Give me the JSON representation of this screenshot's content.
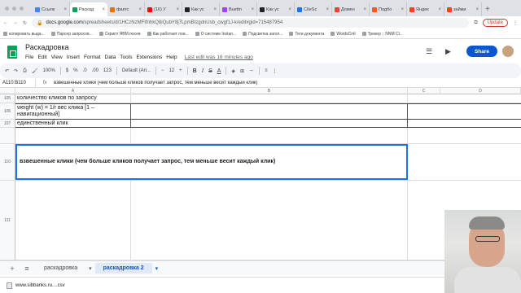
{
  "browser": {
    "tabs": [
      {
        "label": "Ссылк",
        "color": "#4285f4",
        "active": false
      },
      {
        "label": "Раскад",
        "color": "#0f9d58",
        "active": true
      },
      {
        "label": "фактс",
        "color": "#e8710a",
        "active": false
      },
      {
        "label": "(16) У",
        "color": "#ff0000",
        "active": false
      },
      {
        "label": "Как ус",
        "color": "#202124",
        "active": false
      },
      {
        "label": "Buettn",
        "color": "#a142f4",
        "active": false
      },
      {
        "label": "Как ус",
        "color": "#202124",
        "active": false
      },
      {
        "label": "CiteSc",
        "color": "#1a73e8",
        "active": false
      },
      {
        "label": "Домен",
        "color": "#ea4335",
        "active": false
      },
      {
        "label": "Подбо",
        "color": "#ff5722",
        "active": false
      },
      {
        "label": "Яндек",
        "color": "#fc3f1d",
        "active": false
      },
      {
        "label": "займи",
        "color": "#fc3f1d",
        "active": false
      }
    ],
    "url_host": "docs.google.com",
    "url_rest": "/spreadsheets/d/1HCzNzMFIfnhkQ8iQubY8j7LpmBIzgdnUsb_cwgf1J-k/edit#gid=715487954",
    "update_label": "Update",
    "bookmarks": [
      "копировать выда...",
      "Парсер запросов...",
      "Скрипт ЯВМ поcев",
      "Как работает пои...",
      "О системе Instan...",
      "Подсветка загол...",
      "Теги документа",
      "WordsCntl",
      "Трекер :: NNM Cl..."
    ]
  },
  "doc": {
    "title": "Раскадровка",
    "menus": [
      "File",
      "Edit",
      "View",
      "Insert",
      "Format",
      "Data",
      "Tools",
      "Extensions",
      "Help"
    ],
    "last_edit": "Last edit was 16 minutes ago",
    "share_label": "Share"
  },
  "toolbar": {
    "zoom": "100%",
    "currency": "$",
    "percent": "%",
    "dec1": ".0",
    "dec2": ".00",
    "numfmt": "123",
    "font": "Default (Ari...",
    "size": "12",
    "bold": "B",
    "italic": "I",
    "strike": "S",
    "textcolor": "A"
  },
  "formula": {
    "namebox": "A110:B110",
    "fx": "fx",
    "content": "взвешенные клики (чем больше кликов получает запрос, тем меньше весит каждый клик)"
  },
  "columns": [
    "A",
    "B",
    "C",
    "D"
  ],
  "rows": [
    {
      "num": "105",
      "a": "количество кликов по запросу",
      "b": ""
    },
    {
      "num": "106",
      "a": "weight (w) = 1/r вес клика [1 – навигационный]",
      "b": ""
    },
    {
      "num": "107",
      "a": "единственный клик",
      "b": ""
    },
    {
      "num": "108",
      "a": "",
      "b": ""
    },
    {
      "num": "110",
      "a": "взвешенные клики (чем больше кликов получает запрос, тем меньше весит каждый клик)",
      "b": ""
    },
    {
      "num": "111",
      "a": "",
      "b": ""
    }
  ],
  "sheets": [
    "раскадровка",
    "раскадровка 2"
  ],
  "downloads": {
    "file": "www.sibbanks.ru....csv"
  }
}
